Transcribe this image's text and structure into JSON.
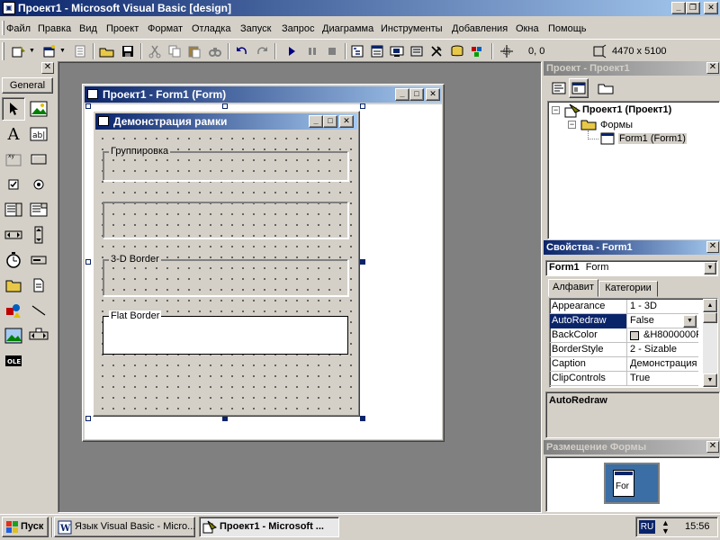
{
  "app": {
    "title": "Проект1 - Microsoft Visual Basic [design]"
  },
  "menu": [
    "Файл",
    "Правка",
    "Вид",
    "Проект",
    "Формат",
    "Отладка",
    "Запуск",
    "Запрос",
    "Диаграмма",
    "Инструменты",
    "Добавления",
    "Окна",
    "Помощь"
  ],
  "toolbar": {
    "position": "0, 0",
    "size": "4470 x 5100"
  },
  "toolbox": {
    "tab_label": "General"
  },
  "designer": {
    "title": "Проект1 - Form1 (Form)"
  },
  "form": {
    "title": "Демонстрация рамки",
    "frames": [
      {
        "caption": "Группировка"
      },
      {
        "caption": ""
      },
      {
        "caption": "3-D Border"
      },
      {
        "caption": "Flat Border"
      }
    ]
  },
  "project": {
    "title": "Проект - Проект1",
    "root": "Проект1 (Проект1)",
    "folder": "Формы",
    "item": "Form1 (Form1)"
  },
  "properties": {
    "title": "Свойства - Form1",
    "object_name": "Form1",
    "object_type": "Form",
    "tabs": [
      "Алфавит",
      "Категории"
    ],
    "rows": [
      {
        "name": "Appearance",
        "value": "1 - 3D"
      },
      {
        "name": "AutoRedraw",
        "value": "False"
      },
      {
        "name": "BackColor",
        "value": "&H8000000F"
      },
      {
        "name": "BorderStyle",
        "value": "2 - Sizable"
      },
      {
        "name": "Caption",
        "value": "Демонстрация"
      },
      {
        "name": "ClipControls",
        "value": "True"
      }
    ],
    "selected": "AutoRedraw",
    "description_title": "AutoRedraw"
  },
  "layout_window": {
    "title": "Размещение Формы",
    "mini_label": "For"
  },
  "taskbar": {
    "start": "Пуск",
    "tasks": [
      "Язык Visual Basic - Micro...",
      "Проект1 - Microsoft ..."
    ],
    "lang": "RU",
    "clock": "15:56"
  },
  "colors": {
    "title_active": "#0a246a",
    "selection": "#0a246a",
    "workspace": "#808080"
  }
}
